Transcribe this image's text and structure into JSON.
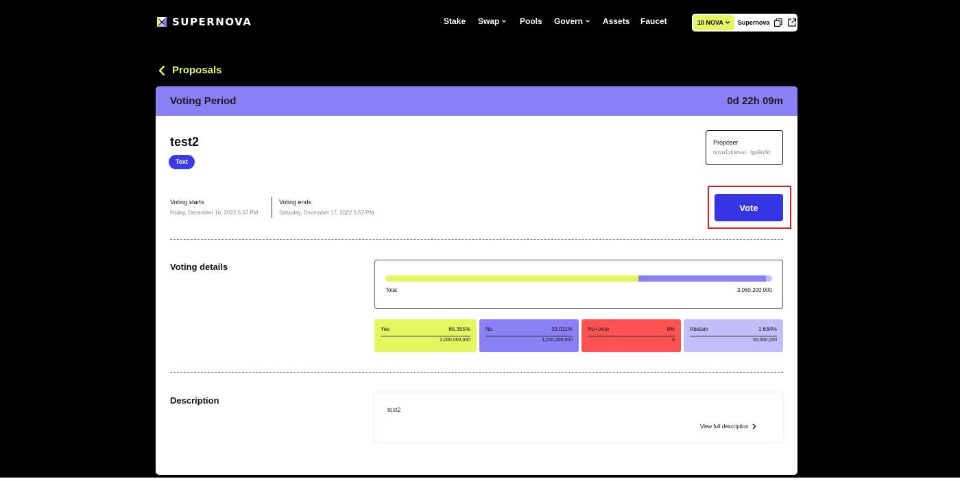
{
  "brand": {
    "name": "SUPERNOVA",
    "logo_colors": [
      "#e3f760",
      "#8b7ff6",
      "#ffffff"
    ]
  },
  "nav": [
    {
      "label": "Stake",
      "dropdown": false
    },
    {
      "label": "Swap",
      "dropdown": true
    },
    {
      "label": "Pools",
      "dropdown": false
    },
    {
      "label": "Govern",
      "dropdown": true
    },
    {
      "label": "Assets",
      "dropdown": false
    },
    {
      "label": "Faucet",
      "dropdown": false
    }
  ],
  "wallet": {
    "balance": "10 NOVA",
    "name": "Supernova",
    "icons": [
      "copy-icon",
      "external-link-icon"
    ]
  },
  "back": {
    "label": "Proposals"
  },
  "header_bar": {
    "status": "Voting Period",
    "countdown": "0d 22h 09m",
    "color": "#8b7ff6"
  },
  "proposal": {
    "title": "test2",
    "type_tag": "Text",
    "proposer_label": "Proposer",
    "proposer_address": "nova1zkarsur...fgu9n3d",
    "voting_starts_label": "Voting starts",
    "voting_starts": "Friday, December 16, 2022 5:57 PM",
    "voting_ends_label": "Voting ends",
    "voting_ends": "Saturday, December 17, 2022 5:57 PM",
    "vote_button": "Vote"
  },
  "voting_details": {
    "label": "Voting details",
    "total_label": "Total",
    "total_value": "3,060,200,000",
    "options": [
      {
        "name": "Yes",
        "percent": "65.355%",
        "amount": "2,000,000,000",
        "color": "#e3f760",
        "share": 0.65355
      },
      {
        "name": "No",
        "percent": "33.011%",
        "amount": "1,010,200,000",
        "color": "#8b7ff6",
        "share": 0.33011
      },
      {
        "name": "No+Veto",
        "percent": "0%",
        "amount": "0",
        "color": "#ff5252",
        "share": 0
      },
      {
        "name": "Abstain",
        "percent": "1.634%",
        "amount": "50,000,000",
        "color": "#c2befa",
        "share": 0.01634
      }
    ]
  },
  "description": {
    "label": "Description",
    "text": "test2",
    "link_label": "View full description"
  }
}
